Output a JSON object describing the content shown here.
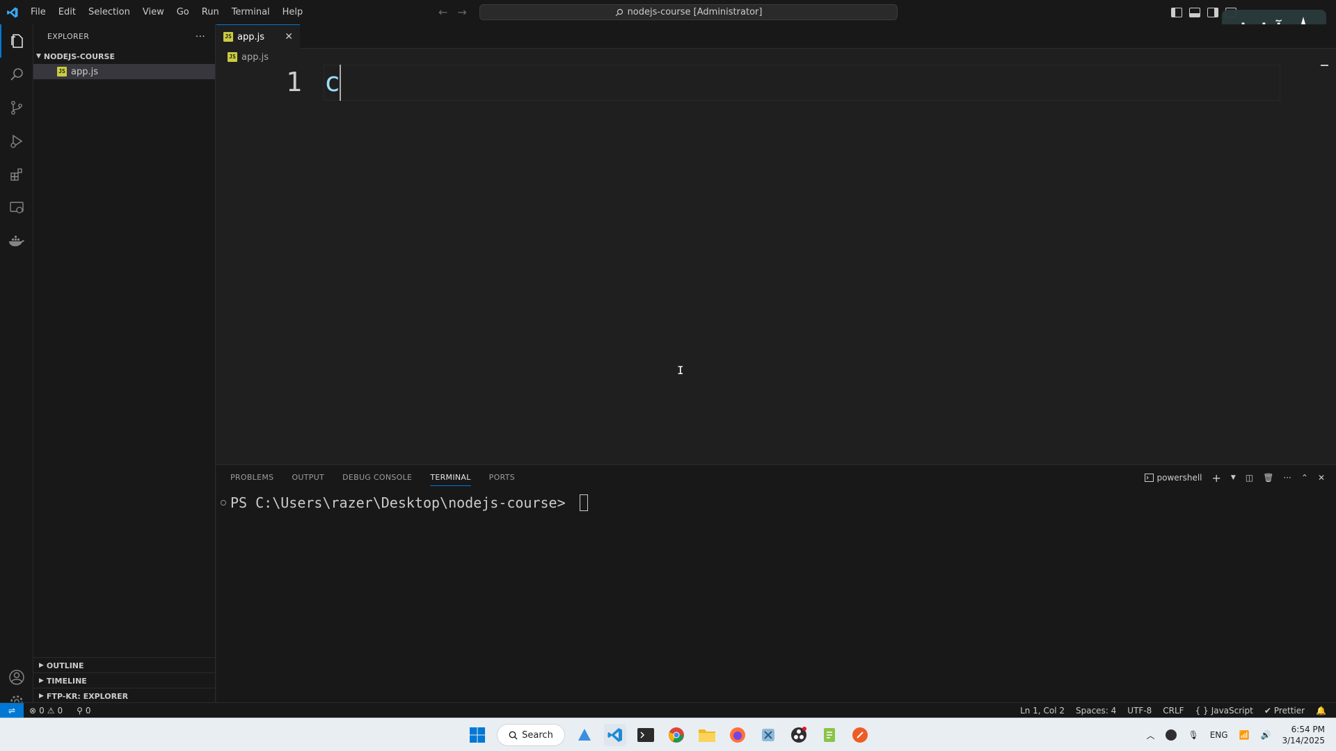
{
  "menu": [
    "File",
    "Edit",
    "Selection",
    "View",
    "Go",
    "Run",
    "Terminal",
    "Help"
  ],
  "command_center": "nodejs-course [Administrator]",
  "watermark": "آواسام",
  "sidebar": {
    "title": "EXPLORER",
    "folder": "NODEJS-COURSE",
    "files": [
      "app.js"
    ],
    "bottom_sections": [
      "OUTLINE",
      "TIMELINE",
      "FTP-KR: EXPLORER"
    ]
  },
  "editor": {
    "tab_label": "app.js",
    "breadcrumb": "app.js",
    "line_number": "1",
    "code": "c"
  },
  "panel": {
    "tabs": [
      "PROBLEMS",
      "OUTPUT",
      "DEBUG CONSOLE",
      "TERMINAL",
      "PORTS"
    ],
    "active_tab": "TERMINAL",
    "shell": "powershell",
    "prompt": "PS C:\\Users\\razer\\Desktop\\nodejs-course>"
  },
  "statusbar": {
    "errors": "0",
    "warnings": "0",
    "ports": "0",
    "position": "Ln 1, Col 2",
    "spaces": "Spaces: 4",
    "encoding": "UTF-8",
    "eol": "CRLF",
    "language": "JavaScript",
    "formatter": "Prettier"
  },
  "taskbar": {
    "search": "Search",
    "lang": "ENG",
    "time": "6:54 PM",
    "date": "3/14/2025"
  },
  "colors": {
    "accent": "#0078d4",
    "editor_bg": "#1f1f1f",
    "chrome_bg": "#181818"
  }
}
